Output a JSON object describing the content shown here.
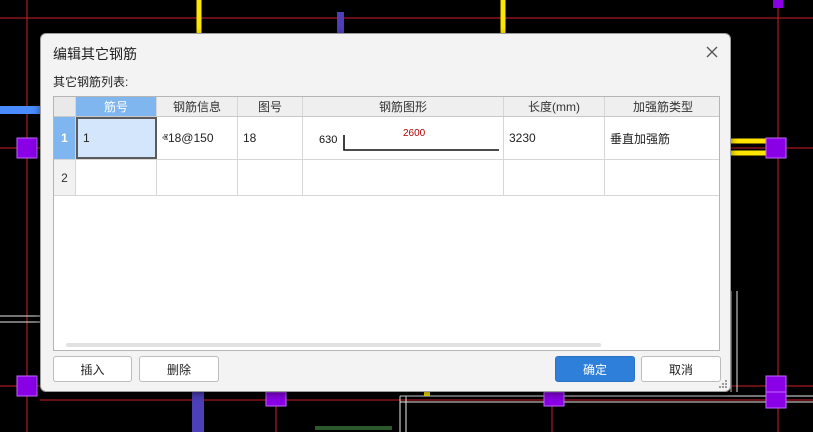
{
  "dialog": {
    "title": "编辑其它钢筋",
    "list_label": "其它钢筋列表:",
    "close_icon": "close-icon"
  },
  "table": {
    "columns": [
      "筋号",
      "钢筋信息",
      "图号",
      "钢筋图形",
      "长度(mm)",
      "加强筋类型"
    ],
    "rows": [
      {
        "row_number": "1",
        "bar_no": "1",
        "bar_info": "ⱏ18@150",
        "figure_no": "18",
        "shape": {
          "left_dim": "630",
          "top_dim": "2600"
        },
        "length": "3230",
        "reinforce_type": "垂直加强筋"
      },
      {
        "row_number": "2",
        "bar_no": "",
        "bar_info": "",
        "figure_no": "",
        "shape": {
          "left_dim": "",
          "top_dim": ""
        },
        "length": "",
        "reinforce_type": ""
      }
    ]
  },
  "buttons": {
    "insert": "插入",
    "delete": "删除",
    "ok": "确定",
    "cancel": "取消"
  },
  "colors": {
    "accent": "#2d7fd9",
    "selected_header": "#7fb6f0",
    "shape_dimension": "#b00000"
  }
}
